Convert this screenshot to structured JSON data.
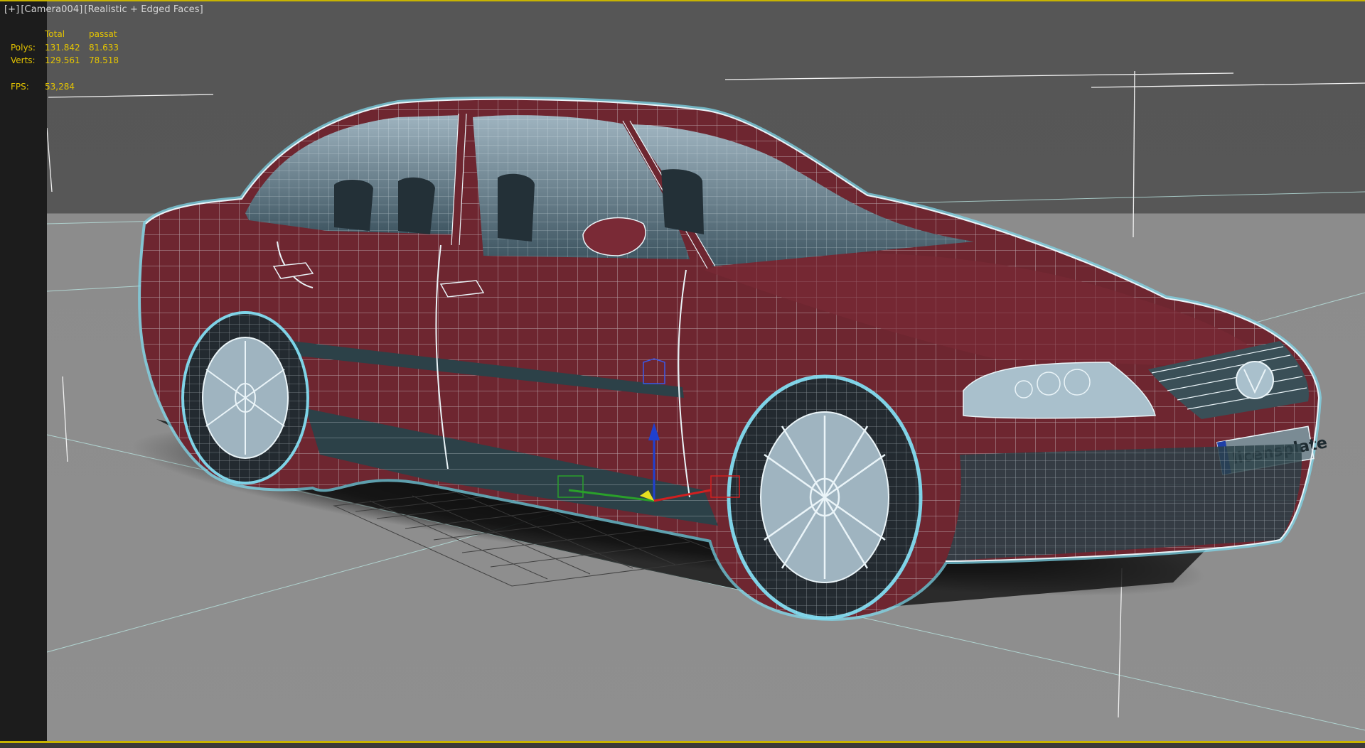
{
  "viewport": {
    "label_parts": [
      "[+]",
      "[Camera004]",
      "[Realistic + Edged Faces]"
    ],
    "render_mode": "Realistic + Edged Faces",
    "camera": "Camera004"
  },
  "stats": {
    "header": {
      "blank": "",
      "total": "Total",
      "object": "passat"
    },
    "polys": {
      "label": "Polys:",
      "total": "131.842",
      "object": "81.633"
    },
    "verts": {
      "label": "Verts:",
      "total": "129.561",
      "object": "78.518"
    },
    "fps": {
      "label": "FPS:",
      "value": "53,284"
    }
  },
  "axis_gizmo": {
    "x": "x",
    "y": "y",
    "z": "z"
  },
  "plate_text": "licensplate",
  "colors": {
    "frame_active": "#c8b400",
    "stats_text": "#e4c400",
    "car_body": "#6e2630",
    "wire": "#e8f4f8",
    "selection_glow": "#7fdcf0"
  }
}
